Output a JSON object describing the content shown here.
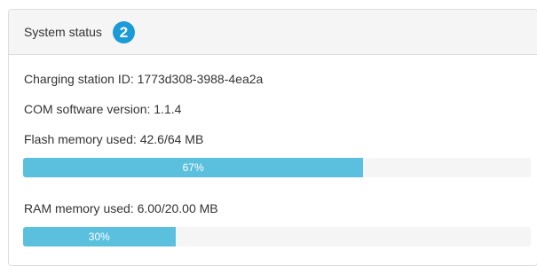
{
  "system_status": {
    "title": "System status",
    "step_badge": "2",
    "badge_color": "#1a9bd7",
    "charging_station_id": "Charging station ID: 1773d308-3988-4ea2a",
    "com_software_version": "COM software version: 1.1.4",
    "flash_memory": {
      "label": "Flash memory used: 42.6/64 MB",
      "percent_label": "67%",
      "percent": 67
    },
    "ram_memory": {
      "label": "RAM memory used: 6.00/20.00 MB",
      "percent_label": "30%",
      "percent": 30
    },
    "progress_color": "#5bc0de"
  }
}
